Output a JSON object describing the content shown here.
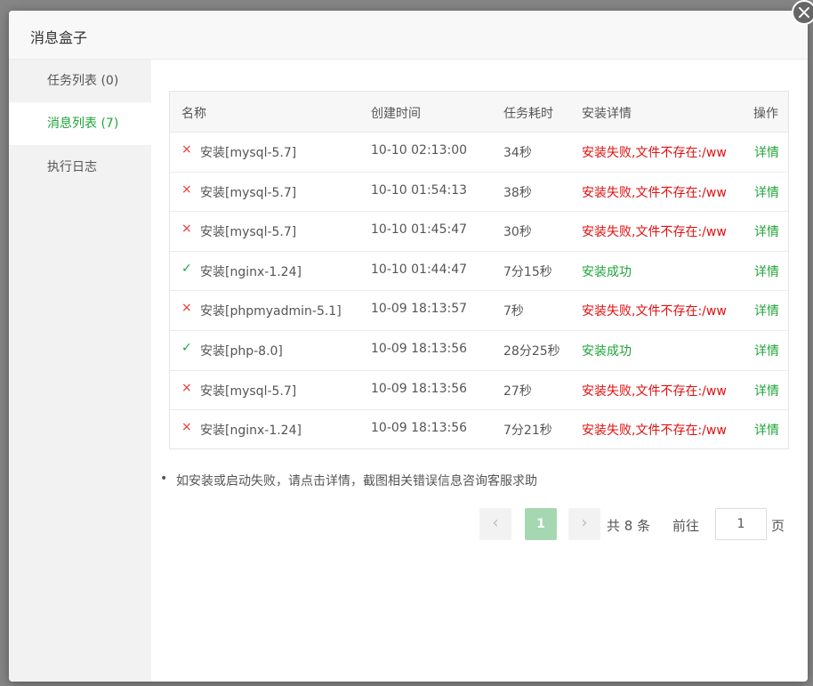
{
  "modal": {
    "title": "消息盒子",
    "close_glyph": "×"
  },
  "sidebar": {
    "items": [
      {
        "label": "任务列表 (0)"
      },
      {
        "label": "消息列表 (7)"
      },
      {
        "label": "执行日志"
      }
    ]
  },
  "table": {
    "headers": [
      "名称",
      "创建时间",
      "任务耗时",
      "安装详情",
      "操作"
    ],
    "rows": [
      {
        "status": "fail",
        "icon": "×",
        "name": "安装[mysql-5.7]",
        "time": "10-10 02:13:00",
        "duration": "34秒",
        "detail": "安装失败,文件不存在:/ww",
        "op": "详情"
      },
      {
        "status": "fail",
        "icon": "×",
        "name": "安装[mysql-5.7]",
        "time": "10-10 01:54:13",
        "duration": "38秒",
        "detail": "安装失败,文件不存在:/ww",
        "op": "详情"
      },
      {
        "status": "fail",
        "icon": "×",
        "name": "安装[mysql-5.7]",
        "time": "10-10 01:45:47",
        "duration": "30秒",
        "detail": "安装失败,文件不存在:/ww",
        "op": "详情"
      },
      {
        "status": "ok",
        "icon": "✓",
        "name": "安装[nginx-1.24]",
        "time": "10-10 01:44:47",
        "duration": "7分15秒",
        "detail": "安装成功",
        "op": "详情"
      },
      {
        "status": "fail",
        "icon": "×",
        "name": "安装[phpmyadmin-5.1]",
        "time": "10-09 18:13:57",
        "duration": "7秒",
        "detail": "安装失败,文件不存在:/ww",
        "op": "详情"
      },
      {
        "status": "ok",
        "icon": "✓",
        "name": "安装[php-8.0]",
        "time": "10-09 18:13:56",
        "duration": "28分25秒",
        "detail": "安装成功",
        "op": "详情"
      },
      {
        "status": "fail",
        "icon": "×",
        "name": "安装[mysql-5.7]",
        "time": "10-09 18:13:56",
        "duration": "27秒",
        "detail": "安装失败,文件不存在:/ww",
        "op": "详情"
      },
      {
        "status": "fail",
        "icon": "×",
        "name": "安装[nginx-1.24]",
        "time": "10-09 18:13:56",
        "duration": "7分21秒",
        "detail": "安装失败,文件不存在:/ww",
        "op": "详情"
      }
    ]
  },
  "note": "如安装或启动失败，请点击详情，截图相关错误信息咨询客服求助",
  "pagination": {
    "prev_glyph": "‹",
    "next_glyph": "›",
    "current": "1",
    "total_text": "共 8 条",
    "goto_prefix": "前往",
    "goto_value": "1",
    "goto_suffix": "页"
  },
  "colors": {
    "accent": "#20a53a",
    "error": "#e01010",
    "sidebar_bg": "#f2f2f2",
    "overlay": "#858585"
  }
}
